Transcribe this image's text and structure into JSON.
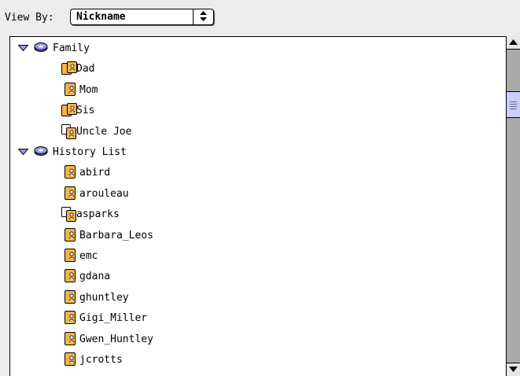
{
  "toolbar": {
    "view_by_label": "View By:",
    "view_by_value": "Nickname"
  },
  "groups": [
    {
      "label": "Family",
      "expanded": true,
      "items": [
        {
          "label": "Dad",
          "icon": "group-card-icon"
        },
        {
          "label": "Mom",
          "icon": "card-icon"
        },
        {
          "label": "Sis",
          "icon": "group-card-icon"
        },
        {
          "label": "Uncle Joe",
          "icon": "mailing-list-icon"
        }
      ]
    },
    {
      "label": "History List",
      "expanded": true,
      "items": [
        {
          "label": "abird",
          "icon": "card-icon"
        },
        {
          "label": "arouleau",
          "icon": "card-icon"
        },
        {
          "label": "asparks",
          "icon": "mailing-list-icon"
        },
        {
          "label": "Barbara_Leos",
          "icon": "card-icon"
        },
        {
          "label": "emc",
          "icon": "card-icon"
        },
        {
          "label": "gdana",
          "icon": "card-icon"
        },
        {
          "label": "ghuntley",
          "icon": "card-icon"
        },
        {
          "label": "Gigi_Miller",
          "icon": "card-icon"
        },
        {
          "label": "Gwen_Huntley",
          "icon": "card-icon"
        },
        {
          "label": "jcrotts",
          "icon": "card-icon"
        }
      ]
    }
  ],
  "colors": {
    "card_fill": "#f5b442",
    "card_outline": "#000000",
    "disc_fill": "#9999ee",
    "scroll_thumb": "#ccccff",
    "scroll_track": "#aaaaaa"
  }
}
